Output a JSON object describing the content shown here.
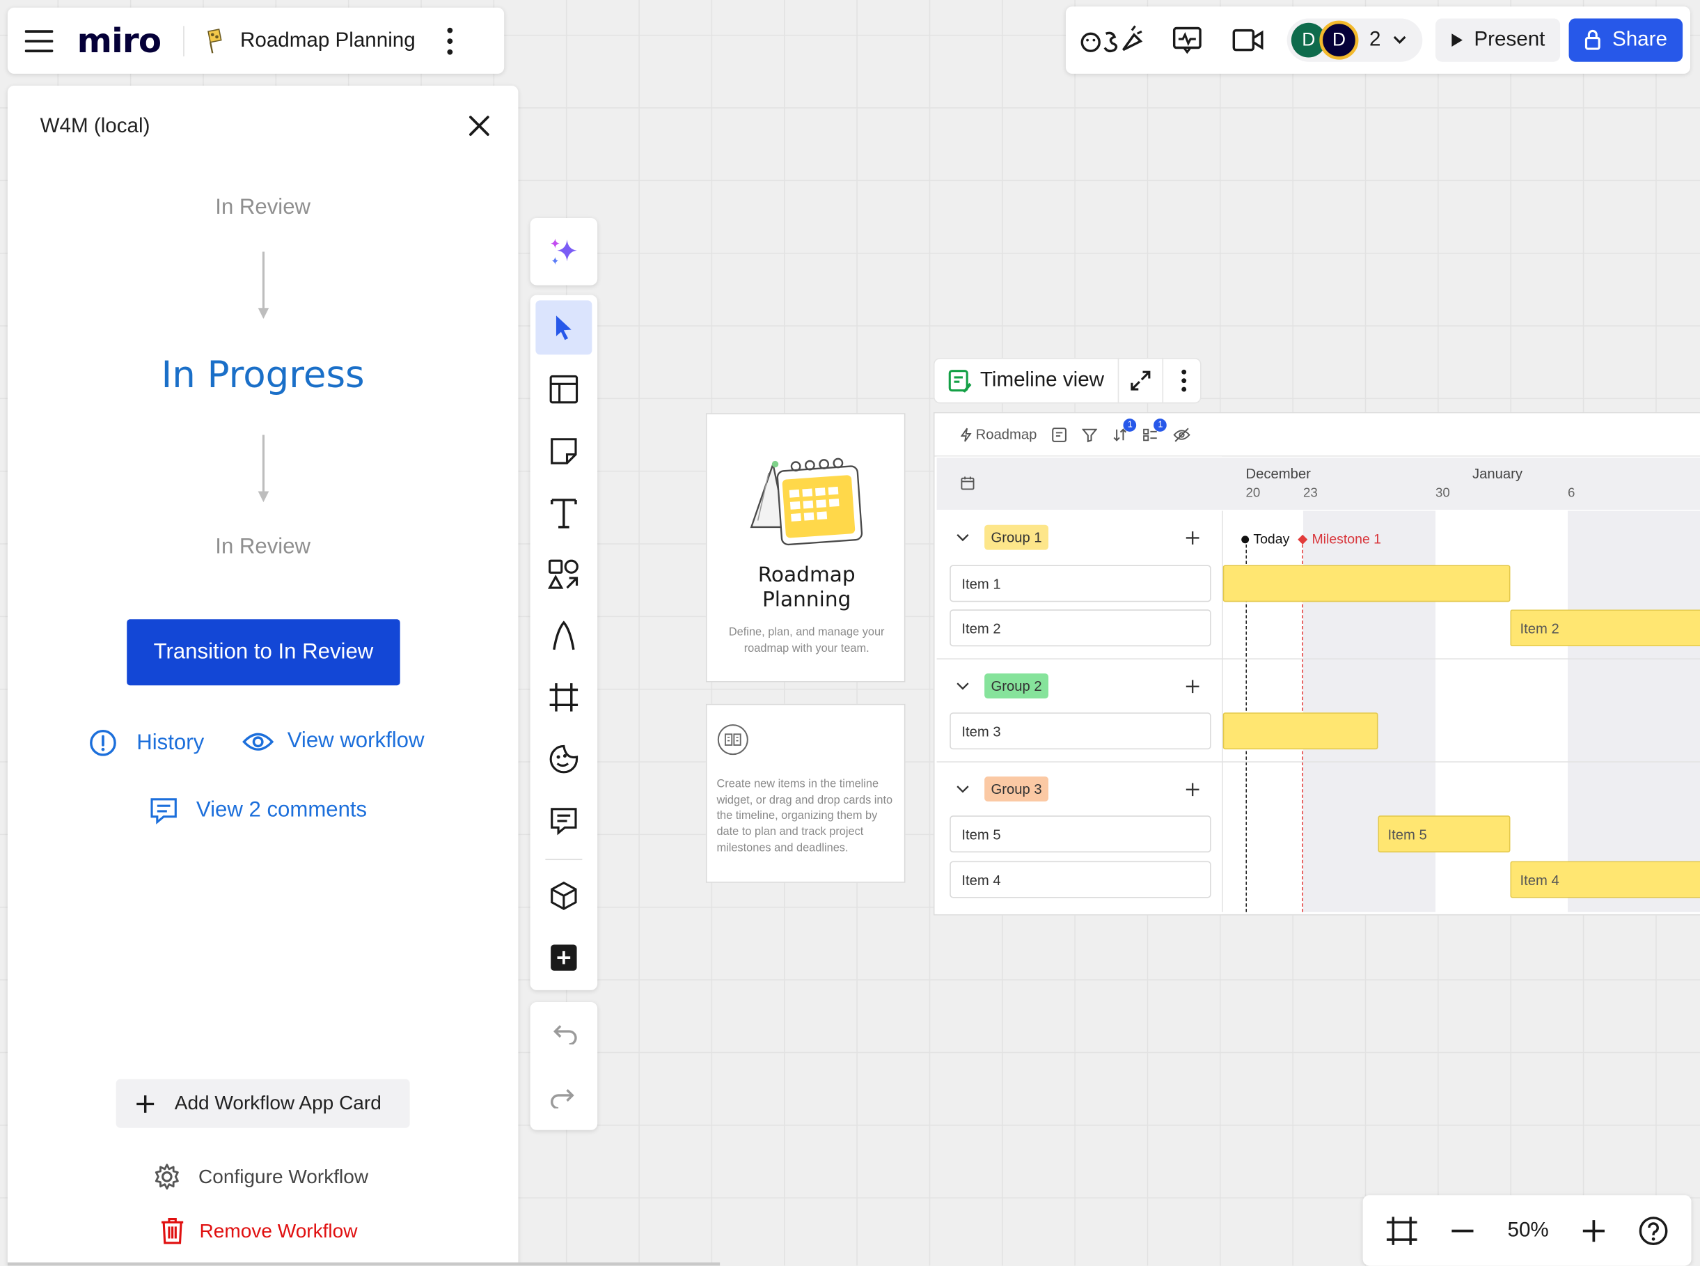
{
  "board": {
    "logo": "miro",
    "name": "Roadmap Planning"
  },
  "collab": {
    "avatars": [
      {
        "initial": "D",
        "color": "#0e6b4c"
      },
      {
        "initial": "D",
        "color": "#050038",
        "ring": "#f2b92d"
      }
    ],
    "count": "2",
    "present_label": "Present",
    "share_label": "Share"
  },
  "panel": {
    "title": "W4M (local)",
    "previous_state": "In Review",
    "current_state": "In Progress",
    "next_state": "In Review",
    "transition_label": "Transition to In Review",
    "history_label": "History",
    "view_workflow_label": "View workflow",
    "comments_label": "View 2 comments",
    "add_card_label": "Add Workflow App Card",
    "configure_label": "Configure Workflow",
    "remove_label": "Remove Workflow"
  },
  "roadmap_card": {
    "title": "Roadmap Planning",
    "subtitle": "Define, plan, and manage your roadmap with your team.",
    "info": "Create new items in the timeline widget, or drag and drop cards into the timeline, organizing them by date to plan and track project milestones and deadlines."
  },
  "timeline": {
    "header_label": "Timeline view",
    "toolbar_label": "Roadmap",
    "sort_badge": "1",
    "group_badge": "1",
    "months": [
      "December",
      "January"
    ],
    "days": [
      "20",
      "23",
      "30",
      "6"
    ],
    "today_label": "Today",
    "milestone_label": "Milestone 1",
    "groups": [
      {
        "name": "Group 1",
        "color": "#fde68a",
        "items": [
          "Item 1",
          "Item 2"
        ]
      },
      {
        "name": "Group 2",
        "color": "#86e39b",
        "items": [
          "Item 3"
        ]
      },
      {
        "name": "Group 3",
        "color": "#fbc9a4",
        "items": [
          "Item 5",
          "Item 4"
        ]
      }
    ],
    "bars": {
      "item2": "Item 2",
      "item5": "Item 5",
      "item4": "Item 4"
    }
  },
  "zoom": {
    "level": "50%"
  },
  "colors": {
    "accent": "#2758e9",
    "transition_button": "#1347d6",
    "state_current": "#1a6fc8",
    "remove": "#e01010",
    "bar_fill": "#ffe671"
  }
}
